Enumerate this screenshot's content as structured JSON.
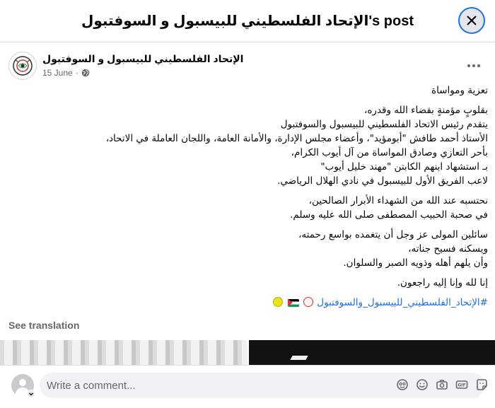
{
  "header": {
    "title": "الإتحاد الفلسطيني للبيسبول و السوفتبول's post",
    "close_icon": "close-icon"
  },
  "post": {
    "page_name": "الإتحاد الفلسطيني للبيسبول و السوفتبول",
    "date": "15 June",
    "separator": "·",
    "audience_icon": "globe-icon",
    "more_icon": "more-options-icon",
    "paragraphs": [
      [
        "تعزية ومواساة"
      ],
      [
        "بقلوبٍ مؤمنةٍ بقضاء الله وقدره،",
        "يتقدم رئيس الاتحاد الفلسطيني للبيسبول والسوفتبول",
        "الأستاذ أحمد طافش \"أبومؤيد\"، وأعضاء مجلس الإدارة، والأمانة العامة، واللجان العاملة في الاتحاد،",
        "بأحر التعازي وصادق المواساة من آل أيوب الكرام،",
        "بـ استشهاد ابنهم الكابتن \"مهند خليل أيوب\"",
        "لاعب الفريق الأول للبيسبول في نادي الهلال الرياضي."
      ],
      [
        "نحتسبه عند الله من الشهداء الأبرار الصالحين،",
        "في صحبة الحبيب المصطفى صلى الله عليه وسلم."
      ],
      [
        "سائلين المولى عز وجل أن يتغمده بواسع رحمته،",
        "ويسكنه فسيح جناته،",
        "وأن يلهم أهله وذويه الصبر والسلوان."
      ],
      [
        "إنا لله وإنا إليه راجعون."
      ]
    ],
    "hashtag": "#الإتحاد_الفلسطيني_للبيسبول_والسوفتبول",
    "hashtag_emojis": [
      "baseball-emoji",
      "palestine-flag-emoji",
      "softball-emoji"
    ],
    "see_translation": "See translation"
  },
  "comment": {
    "placeholder": "Write a comment...",
    "tools": [
      "sticker-icon",
      "emoji-icon",
      "camera-icon",
      "gif-icon",
      "sticker-face-icon"
    ]
  },
  "colors": {
    "link": "#216fdb",
    "secondary_text": "#65676b",
    "input_bg": "#f0f2f5",
    "accent_ring": "#1b74e4"
  }
}
